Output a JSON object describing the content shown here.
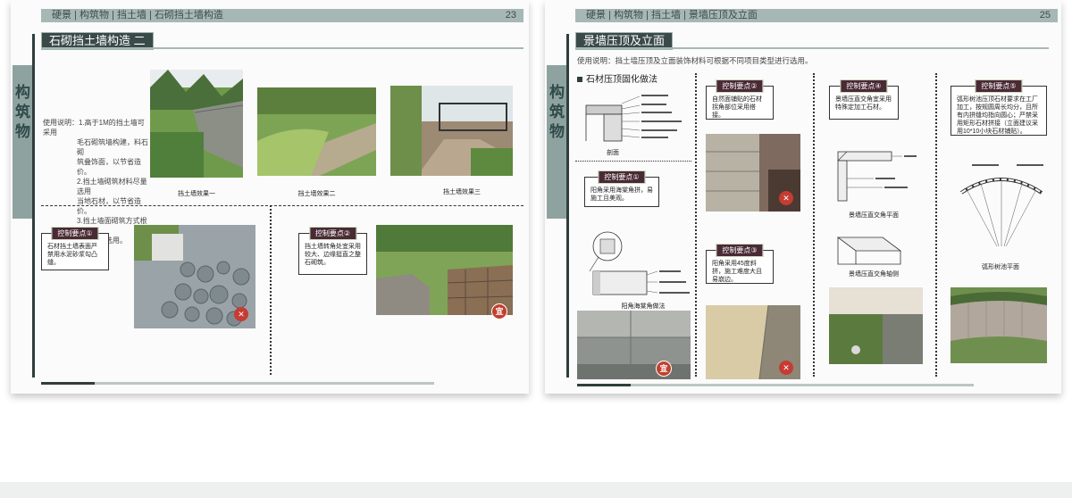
{
  "left_page": {
    "header": "硬景 | 构筑物 | 挡土墙 | 石砌挡土墙构造",
    "page_number": "23",
    "side_label": "构筑物",
    "title": "石砌挡土墙构造 二",
    "usage_lines": [
      "使用说明：1.高于1M的挡土墙可采用",
      "毛石砌筑墙构建，料石砌",
      "筑叠饰面，以节省造价。",
      "2.挡土墙砌筑材料尽量选用",
      "当地石材，以节省造价。",
      "3.挡土墙面砌筑方式根据",
      "项目类型选用。"
    ],
    "captions": [
      "挡土墙效果一",
      "挡土墙效果二",
      "挡土墙效果三"
    ],
    "control_1": {
      "tag": "控制要点①",
      "text": "石材挡土墙表面严禁用水泥砂浆勾凸缝。"
    },
    "control_2": {
      "tag": "控制要点②",
      "text": "挡土墙转角处宜采用较大、边缘挺直之整石砌筑。"
    },
    "badge_no": "✕",
    "badge_yes": "宜"
  },
  "right_page": {
    "header": "硬景 | 构筑物 | 挡土墙 | 景墙压顶及立面",
    "page_number": "25",
    "side_label": "构筑物",
    "title": "景墙压顶及立面",
    "usage": "使用说明：挡土墙压顶及立面装饰材料可根据不同项目类型进行选用。",
    "section_title": "石材压顶固化做法",
    "diagram_labels": [
      "剖面",
      "阳角海棠角做法",
      "景墙压直交角平面",
      "景墙压直交角轴侧",
      "弧形树池平面"
    ],
    "control_1": {
      "tag": "控制要点①",
      "text": "阳角采用海棠角拼，易施工且美观。"
    },
    "control_2": {
      "tag": "控制要点②",
      "text": "自然面铺贴的石材拐角部位采用搭接。"
    },
    "control_3": {
      "tag": "控制要点③",
      "text": "阳角采用45度斜拼，施工难度大且易崩边。"
    },
    "control_4": {
      "tag": "控制要点④",
      "text": "景墙压直交角宜采用特殊定加工石材。"
    },
    "control_5": {
      "tag": "控制要点⑤",
      "text": "弧形树池压顶石材要求在工厂加工，按规圆周长均分，且所有内拼缝均指向圆心；严禁采用矩形石材拼接（立面建议采用10*10小块石材铺贴）。"
    },
    "badge_no": "✕",
    "badge_yes": "宜"
  }
}
